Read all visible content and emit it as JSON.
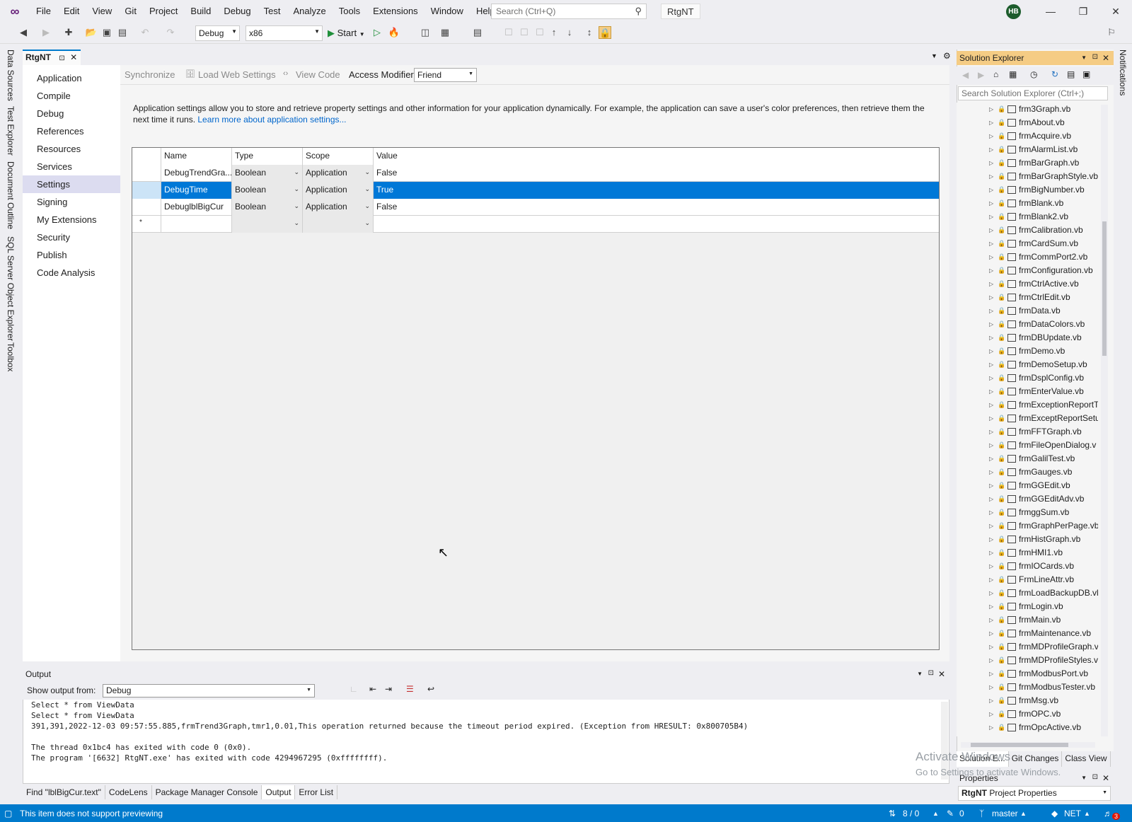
{
  "menubar": {
    "items": [
      "File",
      "Edit",
      "View",
      "Git",
      "Project",
      "Build",
      "Debug",
      "Test",
      "Analyze",
      "Tools",
      "Extensions",
      "Window",
      "Help"
    ],
    "search_placeholder": "Search (Ctrl+Q)",
    "solution_name": "RtgNT",
    "user_initials": "HB"
  },
  "toolbar": {
    "config": "Debug",
    "platform": "x86",
    "start_label": "Start"
  },
  "left_tool_tabs": [
    "Data Sources",
    "Test Explorer",
    "Document Outline",
    "SQL Server Object Explorer",
    "Toolbox"
  ],
  "right_tool_tabs": [
    "Notifications"
  ],
  "document_tab": {
    "title": "RtgNT"
  },
  "project_nav": {
    "items": [
      "Application",
      "Compile",
      "Debug",
      "References",
      "Resources",
      "Services",
      "Settings",
      "Signing",
      "My Extensions",
      "Security",
      "Publish",
      "Code Analysis"
    ],
    "selected": "Settings"
  },
  "settings_toolbar": {
    "synchronize": "Synchronize",
    "load_web_settings": "Load Web Settings",
    "view_code": "View Code",
    "access_modifier_label": "Access Modifier:",
    "access_modifier_value": "Friend"
  },
  "description": {
    "text": "Application settings allow you to store and retrieve property settings and other information for your application dynamically. For example, the application can save a user's color preferences, then retrieve them the next time it runs.",
    "link": "Learn more about application settings..."
  },
  "settings_grid": {
    "columns": [
      "Name",
      "Type",
      "Scope",
      "Value"
    ],
    "rows": [
      {
        "name": "DebugTrendGra...",
        "type": "Boolean",
        "scope": "Application",
        "value": "False"
      },
      {
        "name": "DebugTime",
        "type": "Boolean",
        "scope": "Application",
        "value": "True"
      },
      {
        "name": "DebuglblBigCur",
        "type": "Boolean",
        "scope": "Application",
        "value": "False"
      }
    ],
    "new_row_marker": "*"
  },
  "output": {
    "title": "Output",
    "show_from_label": "Show output from:",
    "show_from_value": "Debug",
    "lines": [
      "Select * from ViewData",
      "Select * from ViewData",
      "391,391,2022-12-03 09:57:55.885,frmTrend3Graph,tmr1,0.01,This operation returned because the timeout period expired. (Exception from HRESULT: 0x800705B4)",
      "",
      "The thread 0x1bc4 has exited with code 0 (0x0).",
      "The program '[6632] RtgNT.exe' has exited with code 4294967295 (0xffffffff)."
    ]
  },
  "bottom_tabs": [
    "Find \"lblBigCur.text\"",
    "CodeLens",
    "Package Manager Console",
    "Output",
    "Error List"
  ],
  "bottom_active": "Output",
  "statusbar": {
    "message": "This item does not support previewing",
    "line_info": "8 / 0",
    "edits": "0",
    "branch": "master",
    "repo": "NET",
    "notifications": "3"
  },
  "solution_explorer": {
    "title": "Solution Explorer",
    "search_placeholder": "Search Solution Explorer (Ctrl+;)",
    "files": [
      "frm3Graph.vb",
      "frmAbout.vb",
      "frmAcquire.vb",
      "frmAlarmList.vb",
      "frmBarGraph.vb",
      "frmBarGraphStyle.vb",
      "frmBigNumber.vb",
      "frmBlank.vb",
      "frmBlank2.vb",
      "frmCalibration.vb",
      "frmCardSum.vb",
      "frmCommPort2.vb",
      "frmConfiguration.vb",
      "frmCtrlActive.vb",
      "frmCtrlEdit.vb",
      "frmData.vb",
      "frmDataColors.vb",
      "frmDBUpdate.vb",
      "frmDemo.vb",
      "frmDemoSetup.vb",
      "frmDsplConfig.vb",
      "frmEnterValue.vb",
      "frmExceptionReportT",
      "frmExceptReportSetu",
      "frmFFTGraph.vb",
      "frmFileOpenDialog.v",
      "frmGalilTest.vb",
      "frmGauges.vb",
      "frmGGEdit.vb",
      "frmGGEditAdv.vb",
      "frmggSum.vb",
      "frmGraphPerPage.vb",
      "frmHistGraph.vb",
      "frmHMI1.vb",
      "frmIOCards.vb",
      "FrmLineAttr.vb",
      "frmLoadBackupDB.vl",
      "frmLogin.vb",
      "frmMain.vb",
      "frmMaintenance.vb",
      "frmMDProfileGraph.v",
      "frmMDProfileStyles.v",
      "frmModbusPort.vb",
      "frmModbusTester.vb",
      "frmMsg.vb",
      "frmOPC.vb",
      "frmOpcActive.vb"
    ],
    "tabs": [
      "Solution E...",
      "Git Changes",
      "Class View"
    ]
  },
  "properties": {
    "title": "Properties",
    "object": "RtgNT",
    "object_type": "Project Properties"
  },
  "watermark": {
    "line1": "Activate Windows",
    "line2": "Go to Settings to activate Windows."
  }
}
